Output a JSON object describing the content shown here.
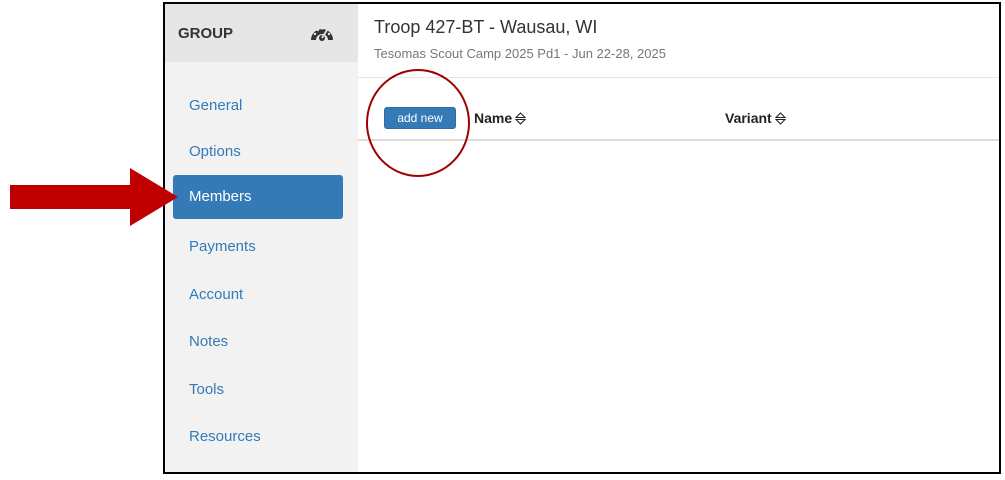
{
  "sidebar": {
    "title": "GROUP",
    "header_icon": "dashboard-gauge-icon",
    "items": [
      {
        "label": "General",
        "active": false
      },
      {
        "label": "Options",
        "active": false
      },
      {
        "label": "Members",
        "active": true
      },
      {
        "label": "Payments",
        "active": false
      },
      {
        "label": "Account",
        "active": false
      },
      {
        "label": "Notes",
        "active": false
      },
      {
        "label": "Tools",
        "active": false
      },
      {
        "label": "Resources",
        "active": false
      }
    ]
  },
  "main": {
    "title": "Troop 427-BT - Wausau, WI",
    "subtitle": "Tesomas Scout Camp 2025 Pd1 - Jun 22-28, 2025",
    "add_button_label": "add new",
    "columns": [
      {
        "label": "Name",
        "sort_icon": "sort-icon"
      },
      {
        "label": "Variant",
        "sort_icon": "sort-icon"
      }
    ]
  },
  "annotations": {
    "arrow_icon": "pointer-arrow-icon",
    "arrow_color": "#c00000",
    "circle_color": "#a00000"
  },
  "colors": {
    "accent": "#337ab7",
    "sidebar_bg": "#f2f2f2",
    "sidebar_header_bg": "#e6e6e6"
  }
}
